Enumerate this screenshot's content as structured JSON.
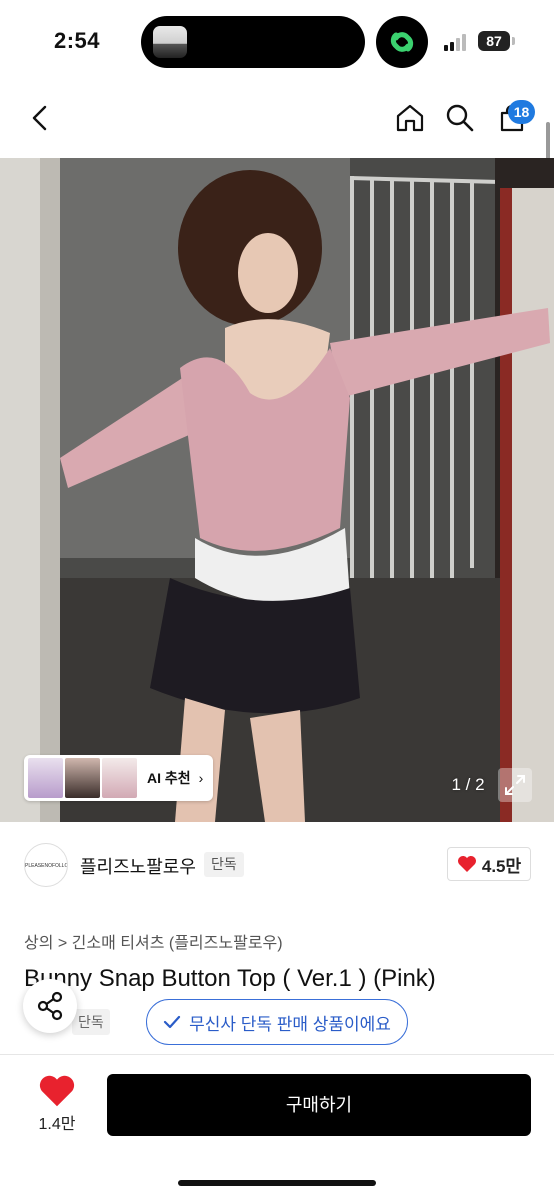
{
  "status_bar": {
    "time": "2:54",
    "battery": "87"
  },
  "app_bar": {
    "cart_count": "18"
  },
  "gallery": {
    "ai_label": "AI 추천",
    "page_indicator": "1 / 2"
  },
  "brand": {
    "logo_text": "PLEASENOFOLLOW",
    "name": "플리즈노팔로우",
    "badge": "단독",
    "likes": "4.5만"
  },
  "product": {
    "breadcrumb": "상의 > 긴소매 티셔츠 (플리즈노팔로우)",
    "title": "Bunny Snap Button Top ( Ver.1 ) (Pink)",
    "exclusive_tag": "단독",
    "exclusive_pill": "무신사 단독 판매 상품이에요"
  },
  "bottom_bar": {
    "like_count": "1.4만",
    "buy_label": "구매하기"
  },
  "colors": {
    "accent_blue": "#1f7ae0",
    "heart_red": "#e8222e",
    "buy_black": "#000000"
  }
}
